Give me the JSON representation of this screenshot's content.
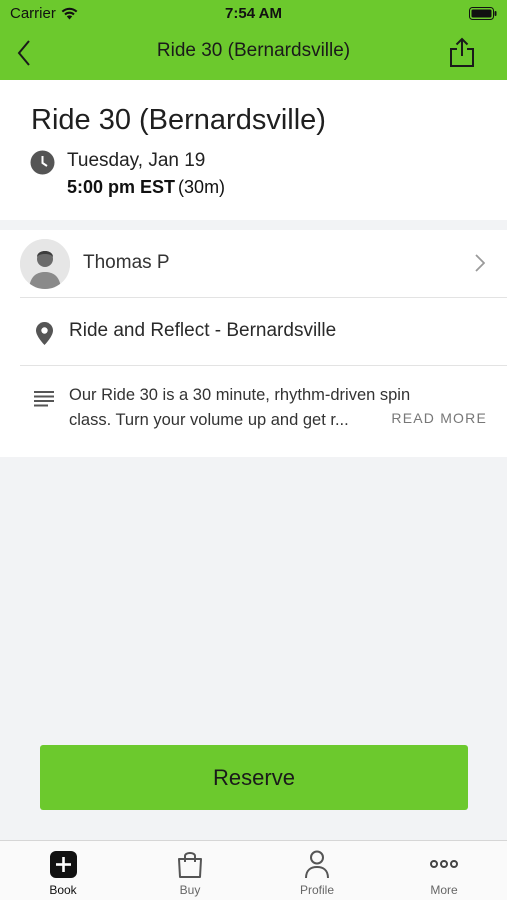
{
  "status_bar": {
    "carrier": "Carrier",
    "time": "7:54 AM"
  },
  "nav": {
    "title": "Ride 30 (Bernardsville)",
    "back_icon": "chevron-left-icon",
    "share_icon": "share-icon"
  },
  "colors": {
    "accent": "#6cc92d",
    "background": "#f2f3f5"
  },
  "class": {
    "title": "Ride 30 (Bernardsville)",
    "date": "Tuesday, Jan 19",
    "time": "5:00 pm EST",
    "duration": "(30m)"
  },
  "instructor": {
    "name": "Thomas P"
  },
  "location": {
    "name": "Ride and Reflect - Bernardsville"
  },
  "description": {
    "text": "Our Ride 30 is a 30 minute, rhythm-driven spin class. Turn your volume up and get r...",
    "read_more": "READ MORE"
  },
  "reserve": {
    "label": "Reserve"
  },
  "tabs": [
    {
      "label": "Book",
      "icon": "plus-square-icon",
      "active": true
    },
    {
      "label": "Buy",
      "icon": "shopping-bag-icon",
      "active": false
    },
    {
      "label": "Profile",
      "icon": "person-icon",
      "active": false
    },
    {
      "label": "More",
      "icon": "ellipsis-icon",
      "active": false
    }
  ]
}
